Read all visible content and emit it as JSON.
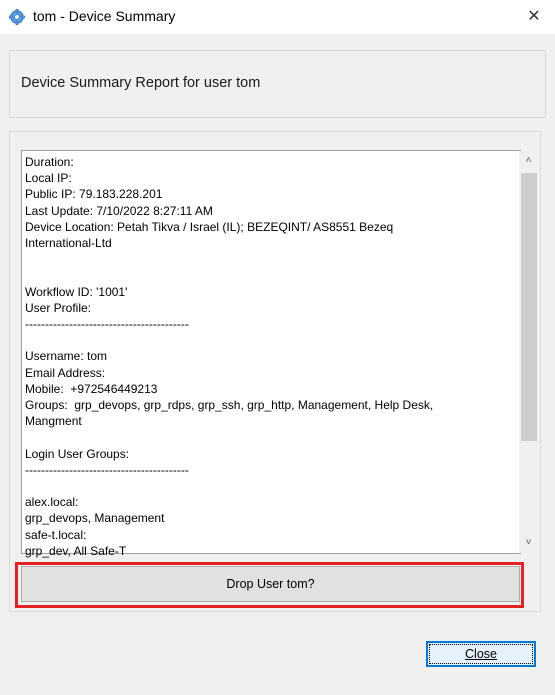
{
  "window": {
    "title": "tom - Device Summary",
    "close_glyph": "✕"
  },
  "header": {
    "text": "Device Summary Report for user  tom"
  },
  "report": {
    "lines": [
      "Duration:",
      "Local IP:",
      "Public IP: 79.183.228.201",
      "Last Update: 7/10/2022 8:27:11 AM",
      "Device Location: Petah Tikva / Israel (IL); BEZEQINT/ AS8551 Bezeq",
      "International-Ltd",
      "",
      "",
      "Workflow ID: '1001'",
      "User Profile:",
      "-----------------------------------------",
      "",
      "Username: tom",
      "Email Address:",
      "Mobile:  +972546449213",
      "Groups:  grp_devops, grp_rdps, grp_ssh, grp_http, Management, Help Desk,",
      "Mangment",
      "",
      "Login User Groups:",
      "-----------------------------------------",
      "",
      "alex.local:",
      "grp_devops, Management",
      "safe-t.local:",
      "grp_dev, All Safe-T"
    ]
  },
  "scrollbar": {
    "up_glyph": "˄",
    "down_glyph": "˅"
  },
  "buttons": {
    "drop_label": "Drop User tom?",
    "close_label": "Close"
  },
  "colors": {
    "highlight": "#e32222",
    "default_button_border": "#0078d7"
  },
  "icons": {
    "title": "gear-icon"
  }
}
